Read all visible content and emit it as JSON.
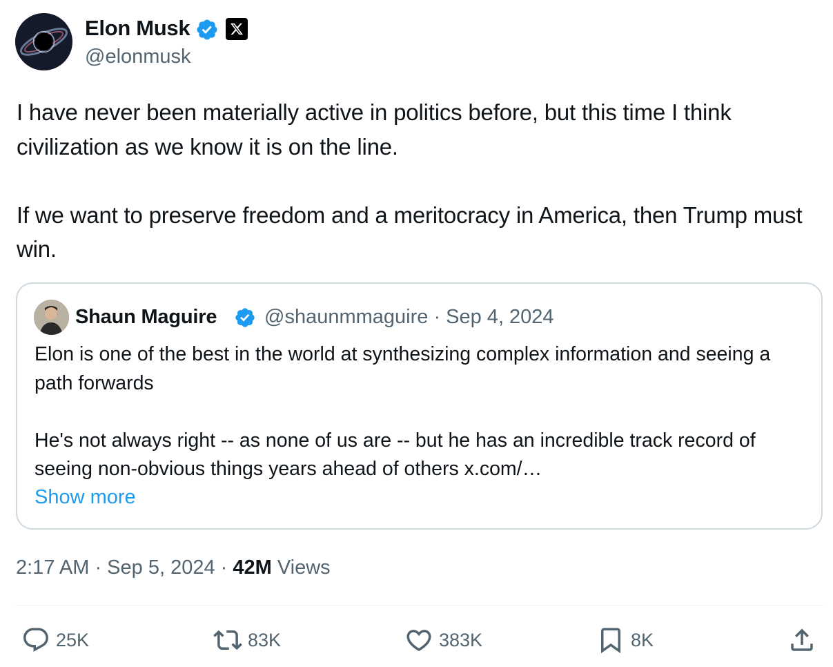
{
  "author": {
    "name": "Elon Musk",
    "handle": "@elonmusk"
  },
  "tweet": {
    "text": "I have never been materially active in politics before, but this time I think civilization as we know it is on the line.\n\nIf we want to preserve freedom and a meritocracy in America, then Trump must win."
  },
  "quote": {
    "name": "Shaun Maguire",
    "meta": "@shaunmmaguire · Sep 4, 2024",
    "text": "Elon is one of the best in the world at synthesizing complex information and seeing a path forwards\n\nHe's not always right -- as none of us are -- but he has an incredible track record of seeing non-obvious things years ahead of others x.com/…",
    "show_more": "Show more"
  },
  "meta": {
    "timestamp": "2:17 AM · Sep 5, 2024 · ",
    "views_count": "42M",
    "views_label": " Views"
  },
  "actions": {
    "replies": "25K",
    "reposts": "83K",
    "likes": "383K",
    "bookmarks": "8K"
  },
  "colors": {
    "accent": "#1d9bf0",
    "text": "#0f1419",
    "secondary": "#536471",
    "border": "#cfd9de"
  }
}
